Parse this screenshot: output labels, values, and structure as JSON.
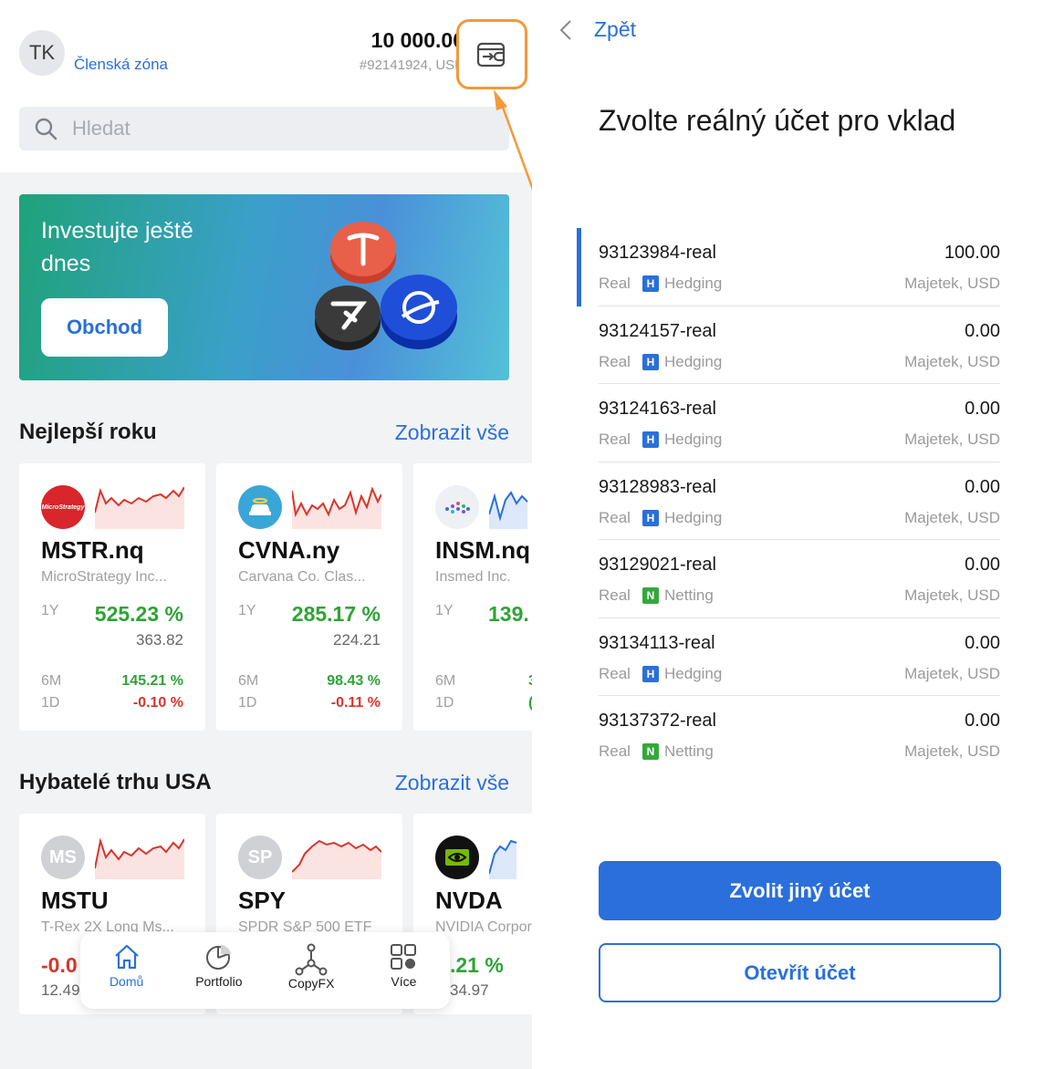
{
  "header": {
    "avatar_initials": "TK",
    "member_zone": "Členská zóna",
    "balance": "10 000.00",
    "account_id": "#92141924, USD",
    "wallet_icon": "wallet-transfer-icon",
    "highlight_color": "#f29a38"
  },
  "search": {
    "placeholder": "Hledat"
  },
  "promo": {
    "title": "Investujte ještě dnes",
    "button": "Obchod"
  },
  "best_of_year": {
    "title": "Nejlepší roku",
    "link": "Zobrazit vše",
    "cards": [
      {
        "ticker": "MSTR.nq",
        "name": "MicroStrategy Inc...",
        "y1_label": "1Y",
        "y1_pct": "525.23 %",
        "price": "363.82",
        "m6_label": "6M",
        "m6_pct": "145.21 %",
        "d1_label": "1D",
        "d1_pct": "-0.10 %",
        "logo_text": "MicroStrategy"
      },
      {
        "ticker": "CVNA.ny",
        "name": "Carvana Co. Clas...",
        "y1_label": "1Y",
        "y1_pct": "285.17 %",
        "price": "224.21",
        "m6_label": "6M",
        "m6_pct": "98.43 %",
        "d1_label": "1D",
        "d1_pct": "-0.11 %"
      },
      {
        "ticker": "INSM.nq",
        "name": "Insmed Inc.",
        "y1_label": "1Y",
        "y1_pct": "139.",
        "price": "",
        "m6_label": "6M",
        "m6_pct": "3",
        "d1_label": "1D",
        "d1_pct": "("
      }
    ]
  },
  "us_movers": {
    "title": "Hybatelé trhu USA",
    "link": "Zobrazit vše",
    "cards": [
      {
        "ticker": "MSTU",
        "name": "T-Rex 2X Long Ms...",
        "logo_text": "MS",
        "pct": "-0.0",
        "price": "12.49"
      },
      {
        "ticker": "SPY",
        "name": "SPDR S&P 500 ETF",
        "logo_text": "SP",
        "pct": "",
        "price": ""
      },
      {
        "ticker": "NVDA",
        "name": "NVIDIA Corporation",
        "logo_text": "",
        "pct": ".21 %",
        "price": "34.97"
      }
    ]
  },
  "bottom_nav": [
    {
      "label": "Domů",
      "icon": "home-icon"
    },
    {
      "label": "Portfolio",
      "icon": "pie-chart-icon"
    },
    {
      "label": "CopyFX",
      "icon": "network-icon"
    },
    {
      "label": "Více",
      "icon": "grid-icon"
    }
  ],
  "right_panel": {
    "back": "Zpět",
    "title": "Zvolte reálný účet pro vklad",
    "accounts": [
      {
        "name": "93123984-real",
        "balance": "100.00",
        "type": "Real",
        "badge": "H",
        "mode": "Hedging",
        "currency": "Majetek, USD"
      },
      {
        "name": "93124157-real",
        "balance": "0.00",
        "type": "Real",
        "badge": "H",
        "mode": "Hedging",
        "currency": "Majetek, USD"
      },
      {
        "name": "93124163-real",
        "balance": "0.00",
        "type": "Real",
        "badge": "H",
        "mode": "Hedging",
        "currency": "Majetek, USD"
      },
      {
        "name": "93128983-real",
        "balance": "0.00",
        "type": "Real",
        "badge": "H",
        "mode": "Hedging",
        "currency": "Majetek, USD"
      },
      {
        "name": "93129021-real",
        "balance": "0.00",
        "type": "Real",
        "badge": "N",
        "mode": "Netting",
        "currency": "Majetek, USD"
      },
      {
        "name": "93134113-real",
        "balance": "0.00",
        "type": "Real",
        "badge": "H",
        "mode": "Hedging",
        "currency": "Majetek, USD"
      },
      {
        "name": "93137372-real",
        "balance": "0.00",
        "type": "Real",
        "badge": "N",
        "mode": "Netting",
        "currency": "Majetek, USD"
      }
    ],
    "primary_button": "Zvolit jiný účet",
    "secondary_button": "Otevřít účet"
  },
  "colors": {
    "accent": "#2a6fdb",
    "positive": "#2fa336",
    "negative": "#d9352b",
    "hedging_badge": "#2a6fdb",
    "netting_badge": "#35a83a"
  }
}
